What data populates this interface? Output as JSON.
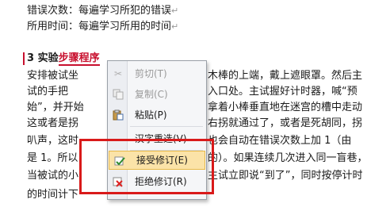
{
  "document": {
    "lines": [
      {
        "text": "错误次数：每遍学习所犯的错误",
        "mark": "↵"
      },
      {
        "text": "所用时间：每遍学习所用的时间",
        "mark": "↵"
      },
      {
        "prefix": "3 实验",
        "highlight": "步骤程序"
      },
      {
        "text": "安排被试坐",
        "right": "木棒的上端，戴上遮眼罩。然后主"
      },
      {
        "text": "试的手把",
        "right": "入口处。主试握好计时器，喊“预"
      },
      {
        "text": "始”，并开始",
        "right": "拿着小棒垂直地在迷宫的槽中走动"
      },
      {
        "text": "这或者是拐",
        "right": "右拐就通过了，或者是死胡同，拐"
      },
      {
        "text": "叭声，这时",
        "right": "也会自动在错误次数上加 1（由"
      },
      {
        "text": "是 1。所以",
        "right": "的）。如果连续几次进入同一盲巷，"
      },
      {
        "text": "当被试的小",
        "right": "主试立即说“到了”，同时按停计时"
      },
      {
        "text": "的时间计下"
      }
    ]
  },
  "context_menu": {
    "items": [
      {
        "label": "剪切(T)",
        "icon": "scissors-icon",
        "disabled": true
      },
      {
        "label": "复制(C)",
        "icon": "copy-icon",
        "disabled": true
      },
      {
        "label": "粘贴(P)",
        "icon": "paste-icon",
        "disabled": false
      },
      {
        "label": "汉字重选(V)",
        "icon": "",
        "disabled": false
      },
      {
        "label": "接受修订(E)",
        "icon": "accept-revision-icon",
        "disabled": false,
        "highlighted": true
      },
      {
        "label": "拒绝修订(R)",
        "icon": "reject-revision-icon",
        "disabled": false
      }
    ]
  }
}
